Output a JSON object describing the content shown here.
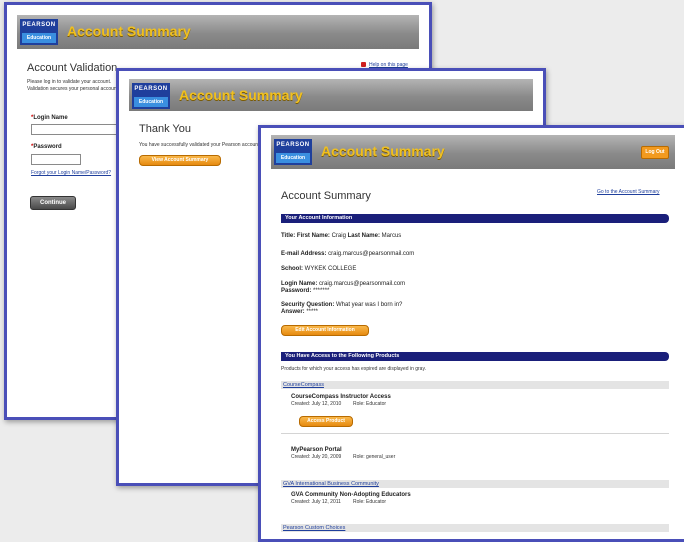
{
  "brand": {
    "logo_top": "PEARSON",
    "logo_bottom": "Education"
  },
  "window1": {
    "header_title": "Account Summary",
    "help_link": "Help on this page",
    "page_title": "Account Validation",
    "intro_line1": "Please log in to validate your account.",
    "intro_line2": "Validation secures your personal account information.",
    "login_label": "Login Name",
    "password_label": "Password",
    "forgot_link": "Forgot your Login Name/Password?",
    "continue_button": "Continue"
  },
  "window2": {
    "header_title": "Account Summary",
    "page_title": "Thank You",
    "message": "You have successfully validated your Pearson account.",
    "view_button": "View Account Summary"
  },
  "window3": {
    "header_title": "Account Summary",
    "logout_button": "Log Out",
    "page_title": "Account Summary",
    "top_link": "Go to the Account Summary",
    "account_bar": "Your Account Information",
    "title_label": "Title:",
    "first_name_label": "First Name:",
    "first_name": "Craig",
    "last_name_label": "Last Name:",
    "last_name": "Marcus",
    "email_label": "E-mail Address:",
    "email": "craig.marcus@pearsonmail.com",
    "school_label": "School:",
    "school": "WYKEK COLLEGE",
    "login_label": "Login Name:",
    "login": "craig.marcus@pearsonmail.com",
    "password_label": "Password:",
    "password": "*******",
    "security_q_label": "Security Question:",
    "security_q": "What year was I born in?",
    "answer_label": "Answer:",
    "answer": "*****",
    "edit_button": "Edit Account Information",
    "products_bar": "You Have Access to the Following Products",
    "products_note": "Products for which your access has expired are displayed in gray.",
    "sections": [
      {
        "name": "CourseCompass",
        "products": [
          {
            "title": "CourseCompass Instructor Access",
            "meta1": "Created: July 12, 2010",
            "meta2": "Role: Educator",
            "button": "Access Product"
          },
          {
            "title": "MyPearson Portal",
            "meta1": "Created: July 20, 2009",
            "meta2": "Role: general_user",
            "button": ""
          }
        ]
      },
      {
        "name": "GVA International Business Community",
        "products": [
          {
            "title": "GVA Community Non-Adopting Educators",
            "meta1": "Created: July 12, 2011",
            "meta2": "Role: Educator",
            "button": ""
          }
        ]
      },
      {
        "name": "Pearson Custom Choices",
        "products": []
      }
    ]
  },
  "colors": {
    "frame": "#4a4fb8",
    "bar": "#1a1f7a",
    "accent": "#f29a1f",
    "title": "#f0c020"
  }
}
